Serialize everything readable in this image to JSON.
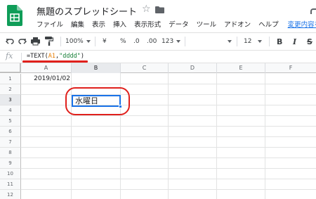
{
  "app": {
    "title": "無題のスプレッドシート",
    "icons": [
      "sheets-logo-icon",
      "star-icon",
      "folder-icon"
    ]
  },
  "menubar": {
    "items": [
      "ファイル",
      "編集",
      "表示",
      "挿入",
      "表示形式",
      "データ",
      "ツール",
      "アドオン",
      "ヘルプ"
    ],
    "changes_link": "変更内容を"
  },
  "toolbar": {
    "zoom": "100%",
    "currency": "¥",
    "percent": "%",
    "decrease_decimal": ".0",
    "increase_decimal": ".00",
    "more_formats": "123",
    "font_size": "12",
    "bold": "B",
    "italic": "I",
    "strike": "S"
  },
  "formula_bar": {
    "fx_label": "fx",
    "prefix": "=TEXT(",
    "ref": "A1",
    "comma": ",",
    "string": "\"dddd\"",
    "suffix": ")"
  },
  "grid": {
    "columns": [
      "A",
      "B",
      "C",
      "D",
      "E",
      "F"
    ],
    "rows": [
      "1",
      "2",
      "3",
      "4",
      "5",
      "6",
      "7",
      "8",
      "9",
      "10",
      "11",
      "12"
    ],
    "active_column": "B",
    "active_row": "3",
    "cells": {
      "A1": "2019/01/02",
      "B3": "水曜日"
    }
  },
  "colors": {
    "accent": "#1a73e8",
    "annotation": "#e0201c",
    "sheets_green": "#0f9d58"
  }
}
